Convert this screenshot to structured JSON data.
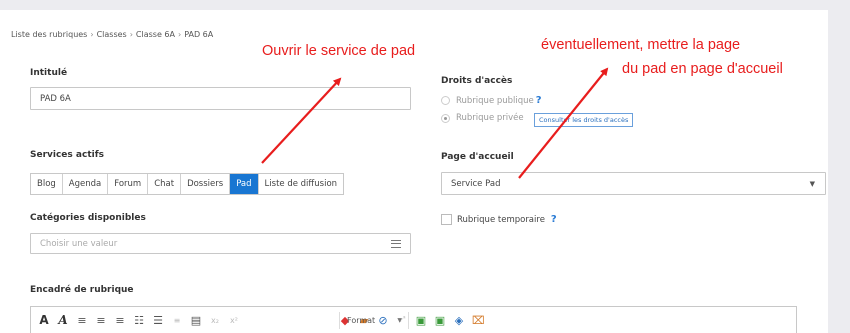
{
  "breadcrumb": [
    "Liste des rubriques",
    "Classes",
    "Classe 6A",
    "PAD 6A"
  ],
  "intitule": {
    "label": "Intitulé",
    "value": "PAD 6A"
  },
  "droits": {
    "label": "Droits d'accès",
    "option_public": "Rubrique publique",
    "option_prive": "Rubrique privée",
    "help": "?",
    "link": "Consulter les droits d'accès"
  },
  "services": {
    "label": "Services actifs",
    "items": [
      "Blog",
      "Agenda",
      "Forum",
      "Chat",
      "Dossiers",
      "Pad",
      "Liste de diffusion"
    ],
    "active": "Pad"
  },
  "accueil": {
    "label": "Page d'accueil",
    "value": "Service Pad"
  },
  "categories": {
    "label": "Catégories disponibles",
    "placeholder": "Choisir une valeur"
  },
  "temporaire": {
    "label": "Rubrique temporaire",
    "help": "?"
  },
  "encadre": {
    "label": "Encadré de rubrique"
  },
  "toolbar": {
    "format": "Format"
  },
  "annotations": {
    "pad": "Ouvrir le service de pad",
    "accueil_line1": "éventuellement, mettre la page",
    "accueil_line2": "du pad en page d'accueil",
    "color": "#e81d1d"
  }
}
